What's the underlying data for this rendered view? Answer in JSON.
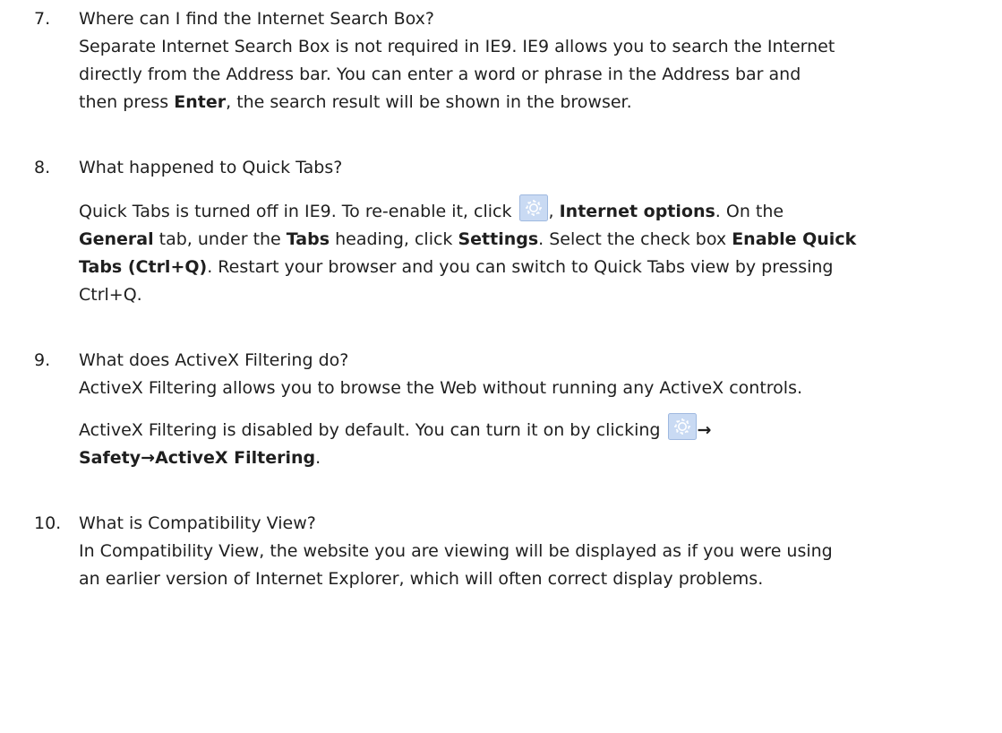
{
  "items": [
    {
      "number": "7.",
      "question": "Where can I find the Internet Search Box?",
      "answer_lines": [
        "Separate Internet Search Box is not required in IE9. IE9 allows you to search the Internet",
        "directly from the Address bar. You can enter a word or phrase in the Address bar and"
      ],
      "answer_last": {
        "pre": "then press ",
        "bold": "Enter",
        "post": ", the search result will be shown in the browser."
      }
    },
    {
      "number": "8.",
      "question": "What happened to Quick Tabs?",
      "line1": {
        "pre": "Quick Tabs is turned off in IE9. To re-enable it, click ",
        "sep": ", ",
        "bold": "Internet options",
        "post": ". On the"
      },
      "line2": {
        "bold1": "General",
        "t1": " tab, under the ",
        "bold2": "Tabs",
        "t2": " heading, click ",
        "bold3": "Settings",
        "t3": ". Select the check box ",
        "bold4": "Enable Quick"
      },
      "line3": {
        "bold": "Tabs (Ctrl+Q)",
        "post": ". Restart your browser and you can switch to Quick Tabs view by pressing"
      },
      "line4": "Ctrl+Q."
    },
    {
      "number": "9.",
      "question": "What does ActiveX Filtering do?",
      "answer1": "ActiveX Filtering allows you to browse the Web without running any ActiveX controls.",
      "answer2_pre": "ActiveX Filtering is disabled by default. You can turn it on by clicking ",
      "arrow": "→",
      "path_safety": "Safety",
      "path_filtering": "ActiveX Filtering",
      "path_end": "."
    },
    {
      "number": "10.",
      "question": "What is Compatibility View?",
      "answer_lines": [
        "In Compatibility View, the website you are viewing will be displayed as if you were using",
        "an earlier version of Internet Explorer, which will often correct display problems."
      ]
    }
  ],
  "icons": {
    "gear": "gear-icon",
    "gear_bg": "#c9daf3",
    "gear_border": "#9fb9e0"
  }
}
